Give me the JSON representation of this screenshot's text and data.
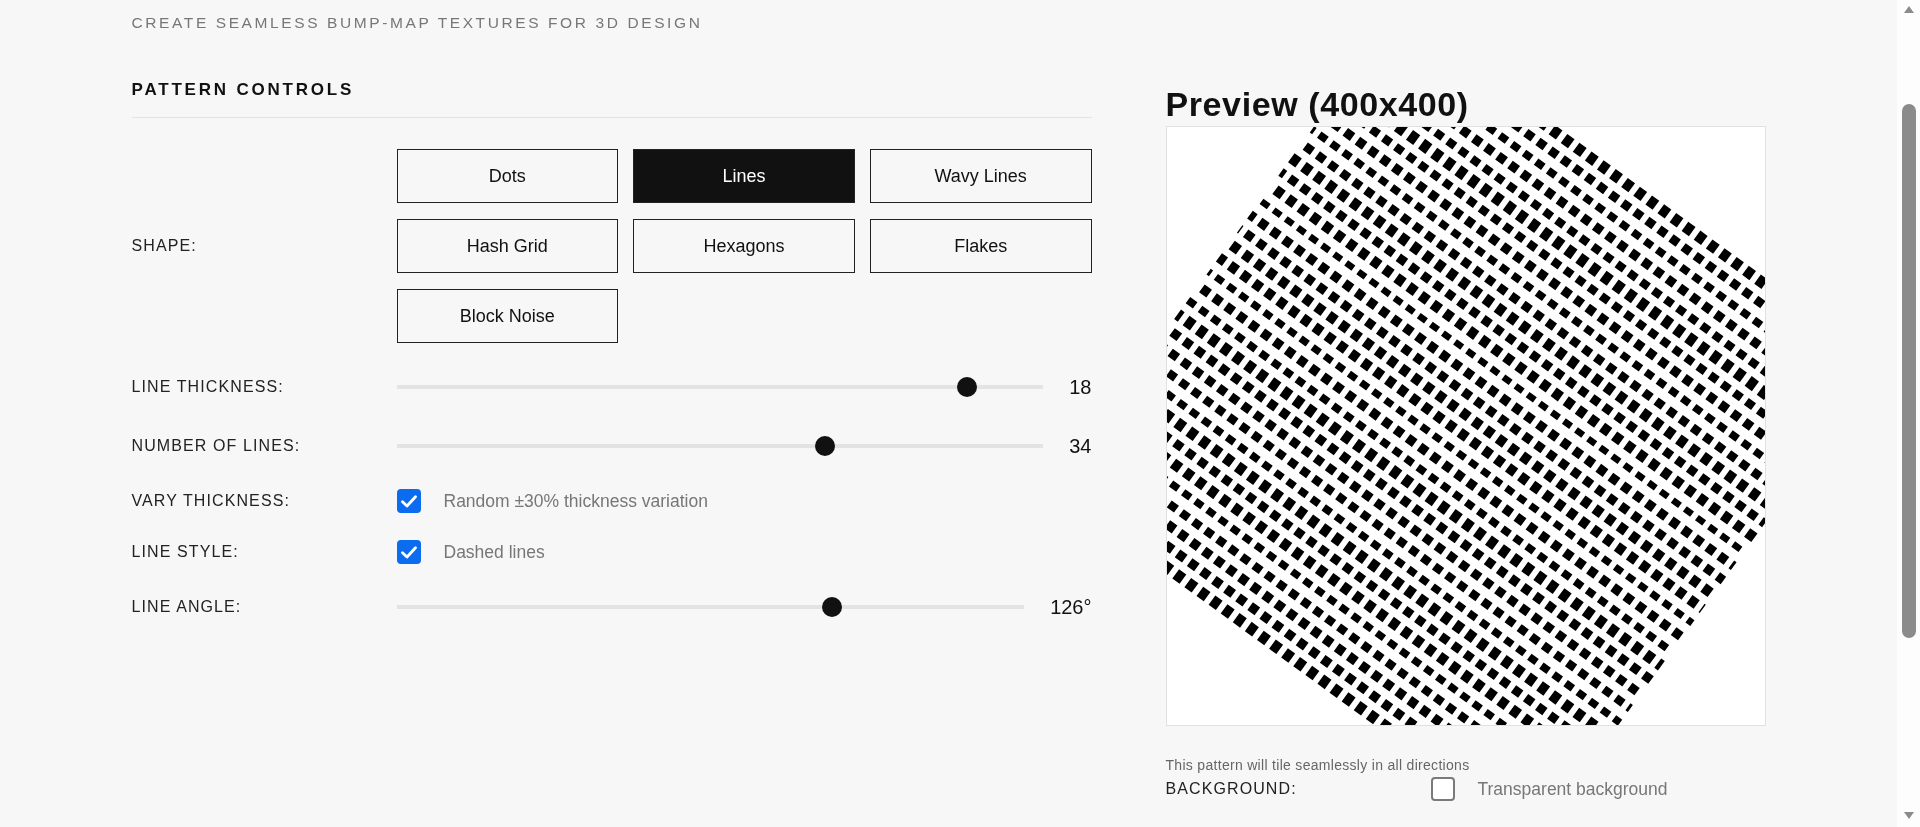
{
  "page": {
    "subtitle": "CREATE SEAMLESS BUMP-MAP TEXTURES FOR 3D DESIGN"
  },
  "controls": {
    "title": "PATTERN CONTROLS",
    "shape": {
      "label": "SHAPE:",
      "options": [
        {
          "label": "Dots",
          "selected": false
        },
        {
          "label": "Lines",
          "selected": true
        },
        {
          "label": "Wavy Lines",
          "selected": false
        },
        {
          "label": "Hash Grid",
          "selected": false
        },
        {
          "label": "Hexagons",
          "selected": false
        },
        {
          "label": "Flakes",
          "selected": false
        },
        {
          "label": "Block Noise",
          "selected": false
        }
      ]
    },
    "rows": [
      {
        "kind": "slider",
        "label": "LINE THICKNESS:",
        "level": 0.894,
        "reading": "18"
      },
      {
        "kind": "slider",
        "label": "NUMBER OF LINES:",
        "level": 0.667,
        "reading": "34"
      },
      {
        "kind": "checkbox",
        "label": "VARY THICKNESS:",
        "checked": true,
        "text": "Random ±30% thickness variation"
      },
      {
        "kind": "checkbox",
        "label": "LINE STYLE:",
        "checked": true,
        "text": "Dashed lines"
      },
      {
        "kind": "slider",
        "label": "LINE ANGLE:",
        "level": 0.7,
        "reading": "126°"
      }
    ]
  },
  "preview": {
    "title": "Preview (400x400)",
    "caption": "This pattern will tile seamlessly in all directions",
    "background": {
      "label": "BACKGROUND:",
      "checked": false,
      "text": "Transparent background"
    }
  }
}
